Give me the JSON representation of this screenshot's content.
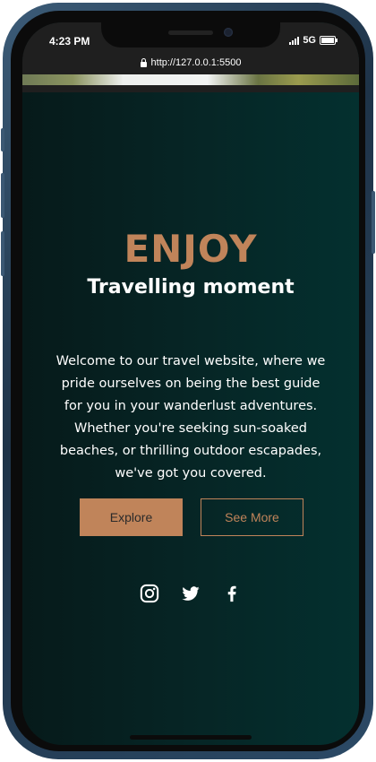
{
  "status": {
    "time": "4:23 PM",
    "network": "5G",
    "url": "http://127.0.0.1:5500"
  },
  "hero": {
    "title": "ENJOY",
    "subtitle": "Travelling moment",
    "description": "Welcome to our travel website, where we pride ourselves on being the best guide for you in your wanderlust adventures. Whether you're seeking sun-soaked beaches, or thrilling outdoor escapades, we've got you covered.",
    "explore_label": "Explore",
    "see_more_label": "See More"
  },
  "social": [
    "instagram-icon",
    "twitter-icon",
    "facebook-icon"
  ],
  "colors": {
    "accent": "#c0845a",
    "background": "#062424",
    "text": "#ffffff"
  }
}
